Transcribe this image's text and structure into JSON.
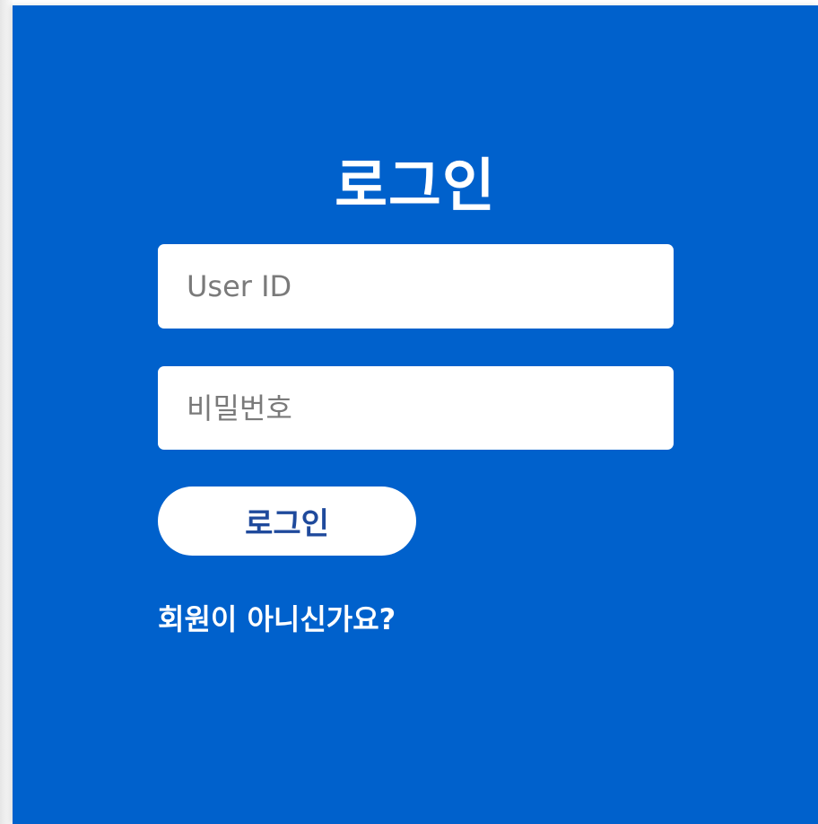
{
  "login": {
    "title": "로그인",
    "userid_placeholder": "User ID",
    "password_placeholder": "비밀번호",
    "submit_label": "로그인",
    "signup_link": "회원이 아니신가요?"
  },
  "colors": {
    "panel_background": "#0061cc",
    "button_text": "#1f4a9c",
    "field_background": "#ffffff"
  }
}
